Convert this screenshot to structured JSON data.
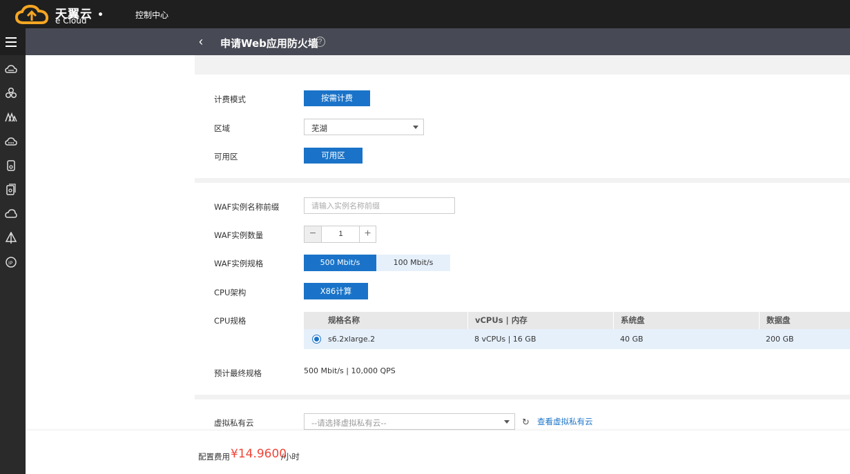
{
  "brand": {
    "name_cn": "天翼云",
    "name_en": "e Cloud",
    "logo_color": "#f5a623"
  },
  "topbar": {
    "console_label": "控制中心"
  },
  "nav": {
    "icons": [
      "menu-icon",
      "cloud-host-icon",
      "network-icon",
      "mountain-icon",
      "cloud-storage-icon",
      "server-icon",
      "database-icon",
      "cloud-icon",
      "sail-icon",
      "ip-icon"
    ]
  },
  "header": {
    "back": "‹",
    "title": "申请Web应用防火墙",
    "help": "?"
  },
  "billing": {
    "mode_label": "计费模式",
    "mode_value": "按需计费",
    "region_label": "区域",
    "region_value": "芜湖",
    "zone_label": "可用区",
    "zone_value": "可用区"
  },
  "instance": {
    "prefix_label": "WAF实例名称前缀",
    "prefix_placeholder": "请输入实例名称前缀",
    "count_label": "WAF实例数量",
    "count_value": "1",
    "spec_label": "WAF实例规格",
    "spec_options": [
      "500 Mbit/s",
      "100 Mbit/s"
    ],
    "cpu_arch_label": "CPU架构",
    "cpu_arch_value": "X86计算",
    "cpu_spec_label": "CPU规格",
    "table": {
      "headers": [
        "规格名称",
        "vCPUs | 内存",
        "系统盘",
        "数据盘"
      ],
      "rows": [
        {
          "name": "s6.2xlarge.2",
          "vcpu_mem": "8 vCPUs | 16 GB",
          "system_disk": "40 GB",
          "data_disk": "200 GB",
          "selected": true
        }
      ]
    },
    "final_label": "预计最终规格",
    "final_value": "500 Mbit/s | 10,000 QPS"
  },
  "vpc": {
    "label": "虚拟私有云",
    "placeholder": "--请选择虚拟私有云--",
    "link": "查看虚拟私有云"
  },
  "footer": {
    "fee_label": "配置费用",
    "fee_value": "¥14.9600",
    "fee_unit": "/小时"
  }
}
